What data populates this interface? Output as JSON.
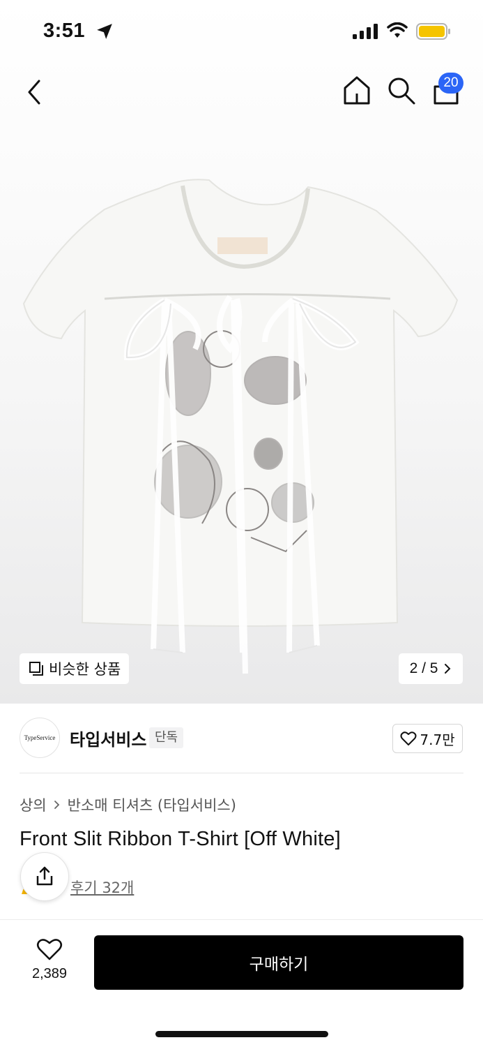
{
  "status_bar": {
    "time": "3:51",
    "icons": [
      "location-arrow-icon",
      "cellular-signal-icon",
      "wifi-icon",
      "battery-icon"
    ],
    "battery_color": "#f5c400"
  },
  "nav": {
    "icons": [
      "back-icon",
      "home-icon",
      "search-icon",
      "cart-icon"
    ],
    "cart_badge": "20",
    "badge_color": "#2b65f6"
  },
  "gallery": {
    "similar_label": "비슷한 상품",
    "pager": "2 / 5"
  },
  "brand": {
    "logo_text": "TypeService",
    "name": "타입서비스",
    "tag": "단독",
    "likes": "7.7만"
  },
  "breadcrumb": {
    "category": "상의",
    "subcategory": "반소매 티셔츠 (타입서비스)"
  },
  "product": {
    "title": "Front Slit Ribbon T-Shirt [Off White]",
    "reviews": "후기 32개"
  },
  "bottom_bar": {
    "wish_count": "2,389",
    "buy_label": "구매하기"
  }
}
